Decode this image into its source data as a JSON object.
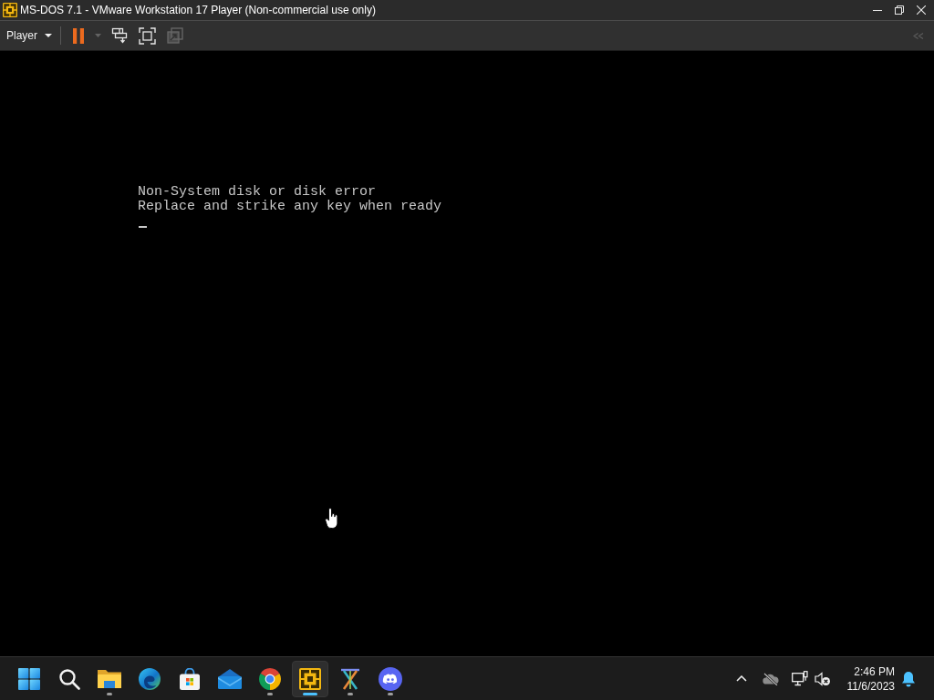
{
  "window": {
    "title": "MS-DOS 7.1 - VMware Workstation 17 Player (Non-commercial use only)"
  },
  "toolbar": {
    "menu": "Player",
    "buttons": [
      {
        "kind": "pause",
        "disabled": false
      },
      {
        "kind": "dropdown",
        "disabled": true
      },
      {
        "kind": "send-keys",
        "disabled": false
      },
      {
        "kind": "fullscreen",
        "disabled": false
      },
      {
        "kind": "unity",
        "disabled": true
      }
    ]
  },
  "console": {
    "lines": [
      "Non-System disk or disk error",
      "Replace and strike any key when ready"
    ]
  },
  "taskbar": {
    "apps": [
      {
        "kind": "start",
        "running": false,
        "selected": false
      },
      {
        "kind": "search",
        "running": false,
        "selected": false
      },
      {
        "kind": "folder",
        "running": true,
        "selected": false
      },
      {
        "kind": "swirl",
        "running": false,
        "selected": false
      },
      {
        "kind": "bag",
        "running": false,
        "selected": false
      },
      {
        "kind": "mail",
        "running": false,
        "selected": false
      },
      {
        "kind": "wheel",
        "running": true,
        "selected": false
      },
      {
        "kind": "pinwheel",
        "running": true,
        "selected": true
      },
      {
        "kind": "cross",
        "running": true,
        "selected": false
      },
      {
        "kind": "gamepad",
        "running": true,
        "selected": false
      }
    ],
    "clock": {
      "time": "2:46 PM",
      "date": "11/6/2023"
    }
  }
}
